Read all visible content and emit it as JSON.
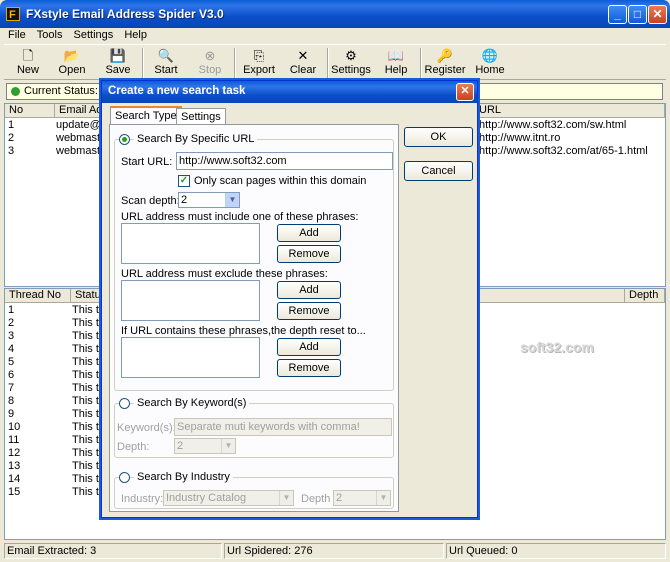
{
  "window": {
    "title": "FXstyle Email Address Spider V3.0"
  },
  "menu": [
    "File",
    "Tools",
    "Settings",
    "Help"
  ],
  "toolbar": [
    {
      "label": "New",
      "icon": "new-file-icon"
    },
    {
      "label": "Open",
      "icon": "open-folder-icon"
    },
    {
      "label": "Save",
      "icon": "save-disk-icon"
    },
    {
      "label": "Start",
      "icon": "start-spider-icon"
    },
    {
      "label": "Stop",
      "icon": "stop-icon"
    },
    {
      "label": "Export",
      "icon": "export-icon"
    },
    {
      "label": "Clear",
      "icon": "clear-x-icon"
    },
    {
      "label": "Settings",
      "icon": "settings-gear-icon"
    },
    {
      "label": "Help",
      "icon": "help-book-icon"
    },
    {
      "label": "Register",
      "icon": "register-key-icon"
    },
    {
      "label": "Home",
      "icon": "home-globe-icon"
    }
  ],
  "current_status": "Current Status: No",
  "email_grid": {
    "headers": [
      "No",
      "Email Addr",
      "URL"
    ],
    "rows": [
      {
        "no": "1",
        "email": "update@s",
        "url": "http://www.soft32.com/sw.html"
      },
      {
        "no": "2",
        "email": "webmaste",
        "url": "http://www.itnt.ro"
      },
      {
        "no": "3",
        "email": "webmaste",
        "url": "http://www.soft32.com/at/65-1.html"
      }
    ]
  },
  "thread_grid": {
    "headers": [
      "Thread No",
      "Status",
      "Depth"
    ],
    "rows": [
      {
        "no": "1",
        "status": "This th"
      },
      {
        "no": "2",
        "status": "This th"
      },
      {
        "no": "3",
        "status": "This th"
      },
      {
        "no": "4",
        "status": "This th"
      },
      {
        "no": "5",
        "status": "This th"
      },
      {
        "no": "6",
        "status": "This th"
      },
      {
        "no": "7",
        "status": "This th"
      },
      {
        "no": "8",
        "status": "This th"
      },
      {
        "no": "9",
        "status": "This th"
      },
      {
        "no": "10",
        "status": "This th"
      },
      {
        "no": "11",
        "status": "This th"
      },
      {
        "no": "12",
        "status": "This th"
      },
      {
        "no": "13",
        "status": "This th"
      },
      {
        "no": "14",
        "status": "This th"
      },
      {
        "no": "15",
        "status": "This th"
      }
    ]
  },
  "statusbar": {
    "emails": "Email Extracted: 3",
    "spidered": "Url Spidered: 276",
    "queued": "Url Queued: 0"
  },
  "watermark": "soft32.com",
  "dialog": {
    "title": "Create a new search task",
    "tabs": [
      "Search Type",
      "Settings"
    ],
    "ok": "OK",
    "cancel": "Cancel",
    "by_url": {
      "label": "Search By Specific URL",
      "start_url_label": "Start URL:",
      "start_url_value": "http://www.soft32.com",
      "only_domain_label": "Only scan pages within this domain",
      "only_domain_checked": true,
      "scan_depth_label": "Scan depth:",
      "scan_depth_value": "2",
      "include_label": "URL address must include one of these phrases:",
      "exclude_label": "URL address must exclude these phrases:",
      "reset_label": "If URL contains these phrases,the depth reset to...",
      "add": "Add",
      "remove": "Remove"
    },
    "by_keyword": {
      "label": "Search By Keyword(s)",
      "keywords_label": "Keyword(s):",
      "keywords_placeholder": "Separate muti keywords with comma!",
      "depth_label": "Depth:",
      "depth_value": "2"
    },
    "by_industry": {
      "label": "Search By Industry",
      "industry_label": "Industry:",
      "industry_value": "Industry Catalog",
      "depth_label": "Depth",
      "depth_value": "2"
    }
  }
}
